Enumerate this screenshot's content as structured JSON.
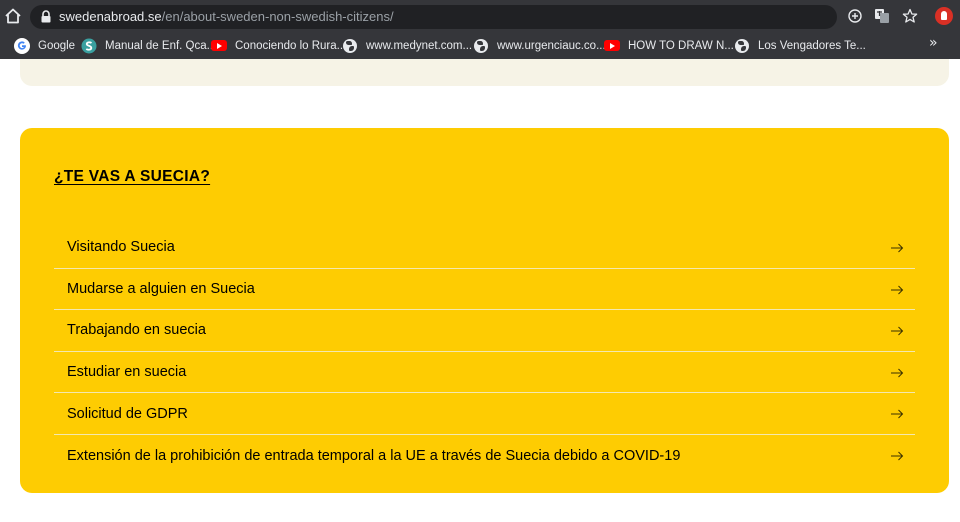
{
  "browser": {
    "url_host": "swedenabroad.se",
    "url_path": "/en/about-sweden-non-swedish-citizens/",
    "toolbar_icons": [
      "home-icon",
      "lock-icon",
      "add-icon",
      "translate-icon",
      "star-icon",
      "extension-icon"
    ],
    "bookmarks": [
      {
        "label": "Google",
        "icon": "google-icon"
      },
      {
        "label": "Manual de Enf. Qca...",
        "icon": "site-icon"
      },
      {
        "label": "Conociendo lo Rura...",
        "icon": "youtube-icon"
      },
      {
        "label": "www.medynet.com...",
        "icon": "globe-icon"
      },
      {
        "label": "www.urgenciauc.co...",
        "icon": "globe-icon"
      },
      {
        "label": "HOW TO DRAW N...",
        "icon": "youtube-icon"
      },
      {
        "label": "Los Vengadores Te...",
        "icon": "globe-icon"
      }
    ],
    "more_bookmarks": "»"
  },
  "section": {
    "title": "¿TE VAS A SUECIA?",
    "accent_color": "#fecc02",
    "links": [
      {
        "label": "Visitando Suecia",
        "icon": "arrow-right-icon"
      },
      {
        "label": "Mudarse a alguien en Suecia",
        "icon": "arrow-right-icon"
      },
      {
        "label": "Trabajando en suecia",
        "icon": "arrow-right-icon"
      },
      {
        "label": "Estudiar en suecia",
        "icon": "arrow-right-icon"
      },
      {
        "label": "Solicitud de GDPR",
        "icon": "arrow-right-icon"
      },
      {
        "label": "Extensión de la prohibición de entrada temporal a la UE a través de Suecia debido a COVID-19",
        "icon": "arrow-right-icon"
      }
    ]
  }
}
